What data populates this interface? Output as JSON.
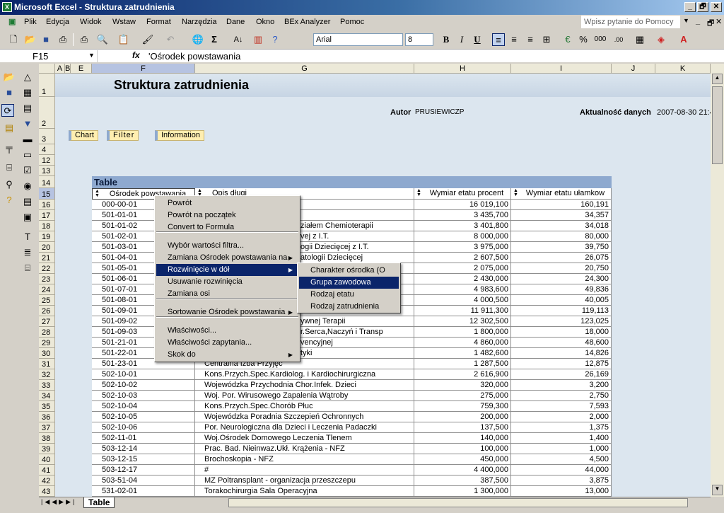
{
  "window": {
    "title": "Microsoft Excel - Struktura zatrudnienia",
    "minimize": "_",
    "restore": "🗗",
    "close": "✕"
  },
  "menu": [
    "Plik",
    "Edycja",
    "Widok",
    "Wstaw",
    "Format",
    "Narzędzia",
    "Dane",
    "Okno",
    "BEx Analyzer",
    "Pomoc"
  ],
  "help_placeholder": "Wpisz pytanie do Pomocy",
  "toolbar": {
    "font": "Arial",
    "size": "8",
    "bold": "B",
    "italic": "I",
    "underline": "U",
    "percent": "%",
    "thousands": "000"
  },
  "namebox": "F15",
  "formula": "'Ośrodek powstawania",
  "columns": [
    "A",
    "B",
    "E",
    "F",
    "G",
    "H",
    "I",
    "J",
    "K"
  ],
  "report": {
    "title": "Struktura zatrudnienia",
    "author_label": "Autor",
    "author": "PRUSIEWICZP",
    "date_label": "Aktualność danych",
    "date": "2007-08-30 21:4",
    "buttons": [
      "Chart",
      "Filter",
      "Information"
    ],
    "table_label": "Table"
  },
  "table": {
    "headers": [
      "Ośrodek powstawania",
      "Opis długi",
      "Wymiar etatu procent",
      "Wymiar etatu ułamkow"
    ],
    "rows": [
      [
        "16",
        "000-00-01",
        "",
        "16 019,100",
        "160,191"
      ],
      [
        "17",
        "501-01-01",
        "",
        "3 435,700",
        "34,357"
      ],
      [
        "18",
        "501-01-02",
        "ziałem Chemioterapii",
        "3 401,800",
        "34,018"
      ],
      [
        "19",
        "501-02-01",
        "vej z I.T.",
        "8 000,000",
        "80,000"
      ],
      [
        "20",
        "501-03-01",
        "ogii Dziecięcej z I.T.",
        "3 975,000",
        "39,750"
      ],
      [
        "21",
        "501-04-01",
        "atologii Dziecięcej",
        "2 607,500",
        "26,075"
      ],
      [
        "22",
        "501-05-01",
        "",
        "2 075,000",
        "20,750"
      ],
      [
        "23",
        "501-06-01",
        "",
        "2 430,000",
        "24,300"
      ],
      [
        "24",
        "501-07-01",
        "",
        "4 983,600",
        "49,836"
      ],
      [
        "25",
        "501-08-01",
        "",
        "4 000,500",
        "40,005"
      ],
      [
        "26",
        "501-09-01",
        "",
        "11 911,300",
        "119,113"
      ],
      [
        "27",
        "501-09-02",
        "ywnej Terapii",
        "12 302,500",
        "123,025"
      ],
      [
        "28",
        "501-09-03",
        "r.Serca,Naczyń i Transp",
        "1 800,000",
        "18,000"
      ],
      [
        "29",
        "501-21-01",
        "vencyjnej",
        "4 860,000",
        "48,600"
      ],
      [
        "30",
        "501-22-01",
        "tyki",
        "1 482,600",
        "14,826"
      ],
      [
        "31",
        "501-23-01",
        "Centralna Izba Przyjęć",
        "1 287,500",
        "12,875"
      ],
      [
        "32",
        "502-10-01",
        "Kons.Przych.Spec.Kardiolog. i Kardiochirurgiczna",
        "2 616,900",
        "26,169"
      ],
      [
        "33",
        "502-10-02",
        "Wojewódzka Przychodnia Chor.Infek. Dzieci",
        "320,000",
        "3,200"
      ],
      [
        "34",
        "502-10-03",
        "Woj. Por. Wirusowego Zapalenia Wątroby",
        "275,000",
        "2,750"
      ],
      [
        "35",
        "502-10-04",
        "Kons.Przych.Spec.Chorób Płuc",
        "759,300",
        "7,593"
      ],
      [
        "36",
        "502-10-05",
        "Wojewódzka Poradnia Szczepień Ochronnych",
        "200,000",
        "2,000"
      ],
      [
        "37",
        "502-10-06",
        "Por. Neurologiczna dla Dzieci i Leczenia Padaczki",
        "137,500",
        "1,375"
      ],
      [
        "38",
        "502-11-01",
        "Woj.Ośrodek Domowego Leczenia Tlenem",
        "140,000",
        "1,400"
      ],
      [
        "39",
        "503-12-14",
        "Prac. Bad. Nieinwaz.Ukł. Krążenia -  NFZ",
        "100,000",
        "1,000"
      ],
      [
        "40",
        "503-12-15",
        "Brochoskopia - NFZ",
        "450,000",
        "4,500"
      ],
      [
        "41",
        "503-12-17",
        "#",
        "4 400,000",
        "44,000"
      ],
      [
        "42",
        "503-51-04",
        "MZ  Poltransplant - organizacja przeszczepu",
        "387,500",
        "3,875"
      ],
      [
        "43",
        "531-02-01",
        "Torakochirurgia Sala Operacyjna",
        "1 300,000",
        "13,000"
      ]
    ]
  },
  "row_headers_top": [
    "1",
    "2",
    "3",
    "4",
    "12",
    "13",
    "14",
    "15"
  ],
  "context_menu": {
    "items": [
      "Powrót",
      "Powrót na początek",
      "Convert to Formula",
      "Wybór wartości filtra...",
      "Zamiana Ośrodek powstawania na",
      "Rozwinięcie  w dół",
      "Usuwanie rozwinięcia",
      "Zamiana osi",
      "Sortowanie Ośrodek powstawania",
      "Właściwości...",
      "Właściwości zapytania...",
      "Skok do"
    ],
    "highlighted": "Rozwinięcie  w dół"
  },
  "submenu": {
    "items": [
      "Charakter ośrodka (O",
      "Grupa zawodowa",
      "Rodzaj etatu",
      "Rodzaj zatrudnienia"
    ],
    "highlighted": "Grupa zawodowa"
  },
  "sheet_tabs": [
    "Table"
  ]
}
